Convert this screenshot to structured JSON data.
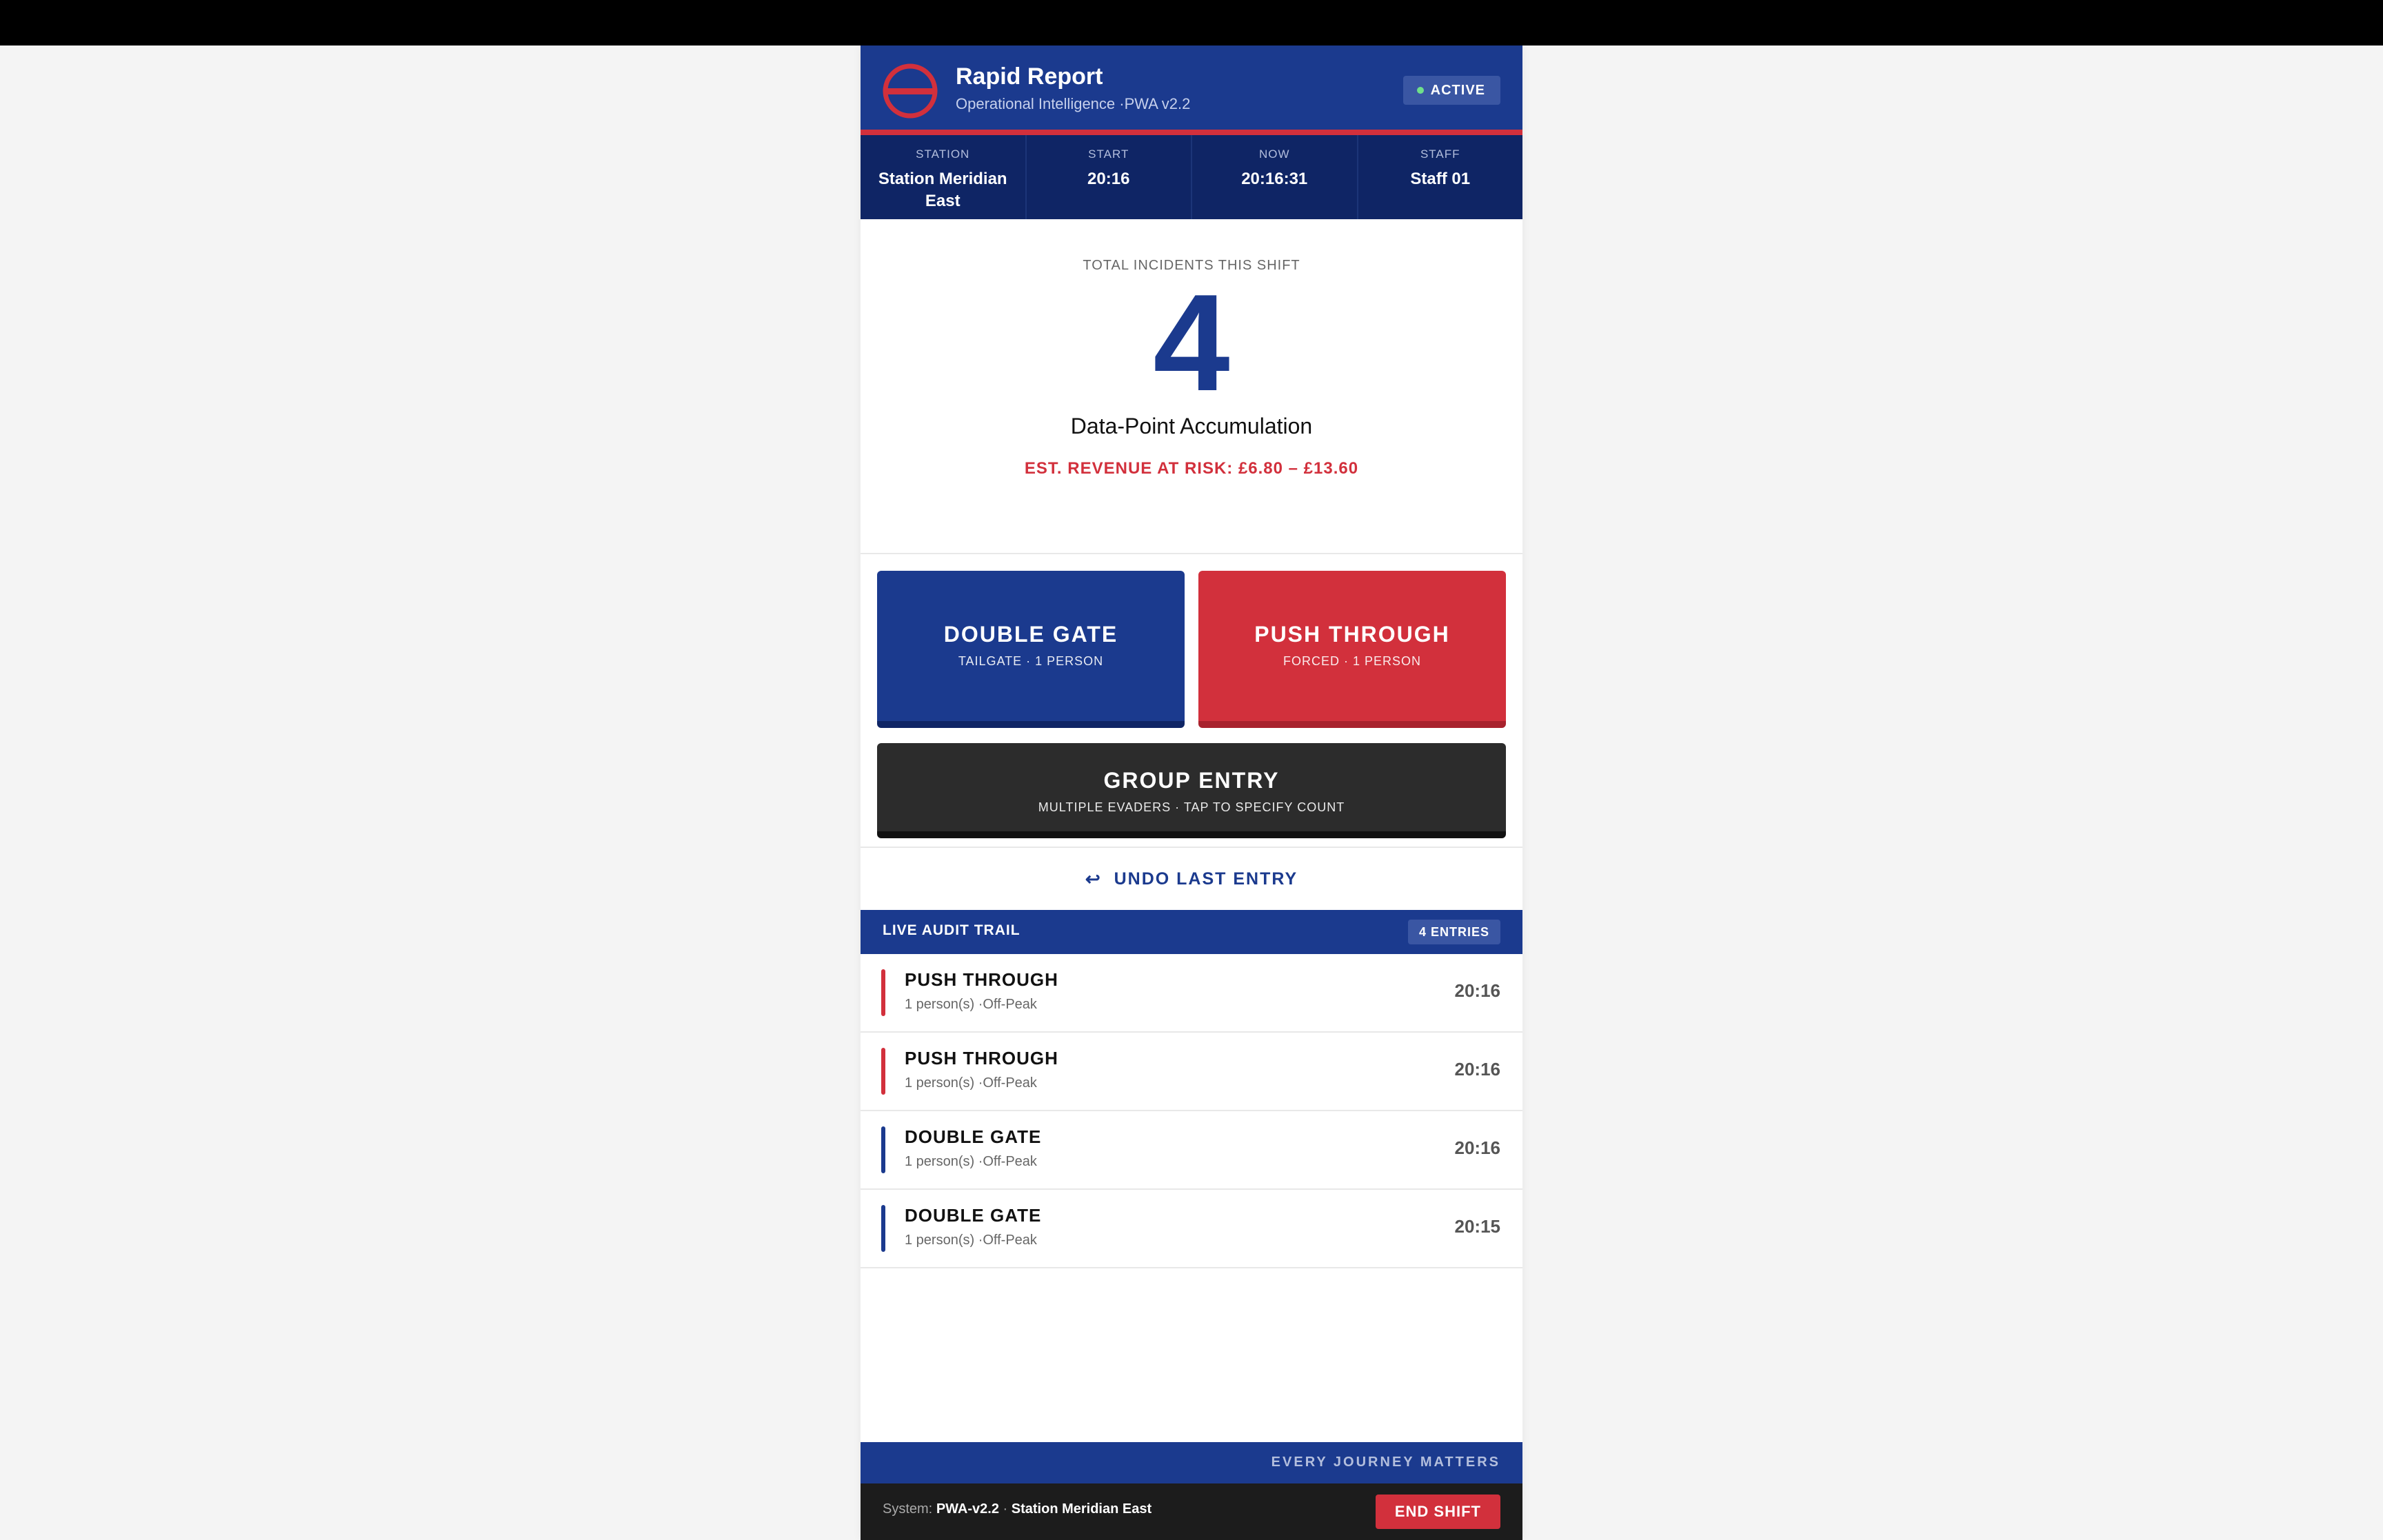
{
  "header": {
    "title": "Rapid Report",
    "subtitle": "Operational Intelligence ·PWA v2.2",
    "status": "ACTIVE"
  },
  "info": [
    {
      "label": "STATION",
      "value": "Station Meridian East"
    },
    {
      "label": "START",
      "value": "20:16"
    },
    {
      "label": "NOW",
      "value": "20:16:31"
    },
    {
      "label": "STAFF",
      "value": "Staff 01"
    }
  ],
  "counter": {
    "label": "TOTAL INCIDENTS THIS SHIFT",
    "value": "4",
    "caption": "Data-Point Accumulation",
    "risk": "EST. REVENUE AT RISK: £6.80 – £13.60"
  },
  "actions": {
    "double_gate": {
      "title": "DOUBLE GATE",
      "sub": "TAILGATE · 1 PERSON"
    },
    "push_through": {
      "title": "PUSH THROUGH",
      "sub": "FORCED · 1 PERSON"
    },
    "group_entry": {
      "title": "GROUP ENTRY",
      "sub": "MULTIPLE EVADERS · TAP TO SPECIFY COUNT"
    }
  },
  "undo": {
    "icon": "↩",
    "label": "UNDO LAST ENTRY"
  },
  "audit": {
    "title": "LIVE AUDIT TRAIL",
    "count": "4 ENTRIES",
    "entries": [
      {
        "type": "PUSH THROUGH",
        "detail": "1 person(s) ·Off-Peak",
        "time": "20:16",
        "color": "red"
      },
      {
        "type": "PUSH THROUGH",
        "detail": "1 person(s) ·Off-Peak",
        "time": "20:16",
        "color": "red"
      },
      {
        "type": "DOUBLE GATE",
        "detail": "1 person(s) ·Off-Peak",
        "time": "20:16",
        "color": "blue"
      },
      {
        "type": "DOUBLE GATE",
        "detail": "1 person(s) ·Off-Peak",
        "time": "20:15",
        "color": "blue"
      }
    ]
  },
  "footer": {
    "slogan": "EVERY JOURNEY MATTERS",
    "system_label": "System:",
    "system_version": "PWA-v2.2",
    "separator": "·",
    "system_station": "Station Meridian East",
    "end_shift": "END SHIFT"
  },
  "colors": {
    "brand_blue": "#1b3a8e",
    "brand_red": "#d2303c",
    "dark_navy": "#0f2565",
    "dark_button": "#2c2c2c"
  }
}
